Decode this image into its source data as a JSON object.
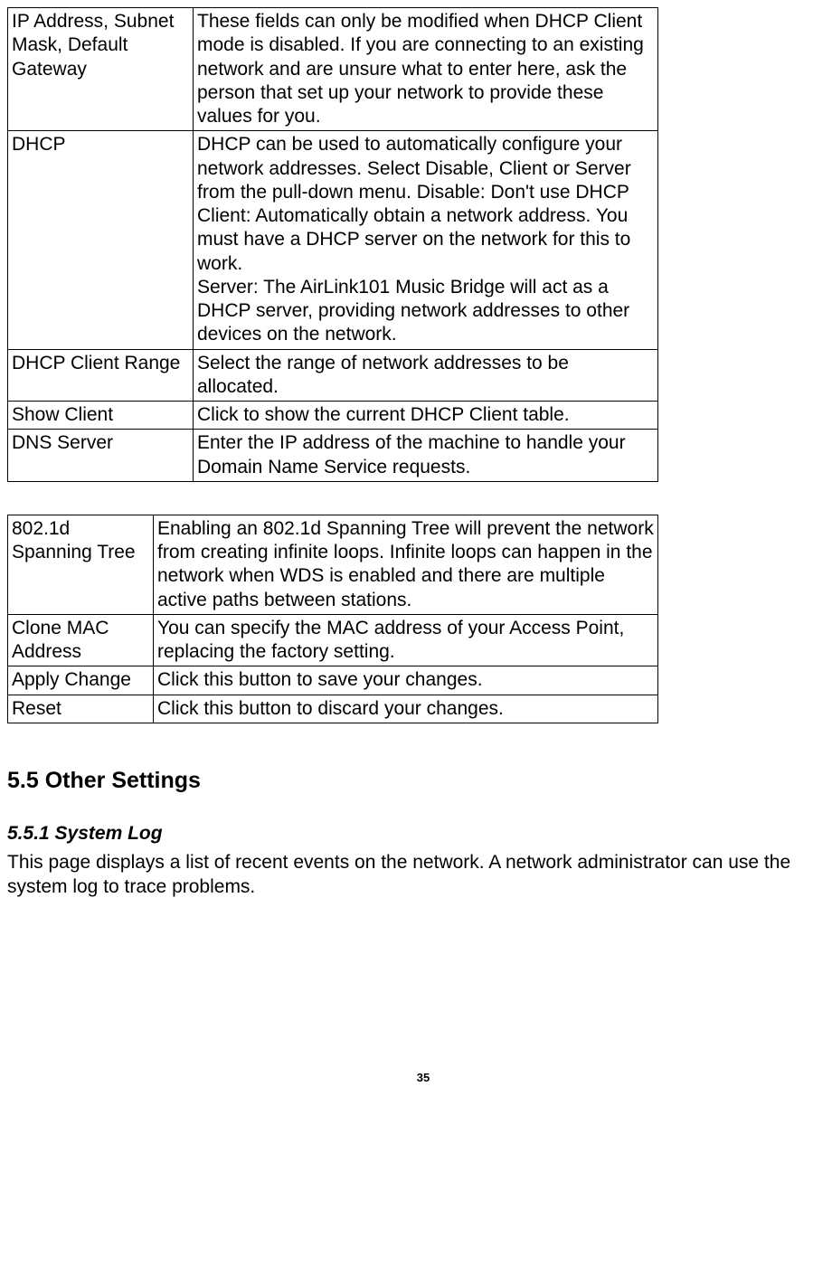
{
  "table1": {
    "rows": [
      {
        "label": "IP Address, Subnet Mask, Default Gateway",
        "desc": "These fields can only be modified when DHCP Client mode is disabled. If you are connecting to an existing network and are unsure what to enter here, ask the person that set up your network to provide these values for you."
      },
      {
        "label": "DHCP",
        "desc": "DHCP can be used to automatically configure your network addresses. Select Disable, Client or Server from the pull-down menu. Disable: Don't use DHCP\nClient: Automatically obtain a network address. You must have a DHCP server on the network for this to work.\nServer: The AirLink101 Music Bridge will act as a DHCP server, providing network addresses to other devices on the network."
      },
      {
        "label": "DHCP Client Range",
        "desc": "Select the range of network addresses to be allocated."
      },
      {
        "label": "Show Client",
        "desc": "Click to show the current DHCP Client table."
      },
      {
        "label": "DNS Server",
        "desc": "Enter the IP address of the machine to handle your Domain Name Service requests."
      }
    ]
  },
  "table2": {
    "rows": [
      {
        "label": "802.1d Spanning Tree",
        "desc": "Enabling an 802.1d Spanning Tree will prevent the network from creating infinite loops. Infinite loops can happen in the network when WDS is enabled and there are multiple active paths between stations."
      },
      {
        "label": "Clone MAC Address",
        "desc": "You can specify the MAC address of your Access Point, replacing the factory setting."
      },
      {
        "label": "Apply Change",
        "desc": "Click this button to save your changes."
      },
      {
        "label": "Reset",
        "desc": "Click this button to discard your changes."
      }
    ]
  },
  "heading_5_5": "5.5 Other Settings",
  "heading_5_5_1": "5.5.1 System Log",
  "paragraph_5_5_1": "This page displays a list of recent events on the network. A network administrator can use the system log to trace problems.",
  "page_number": "35"
}
